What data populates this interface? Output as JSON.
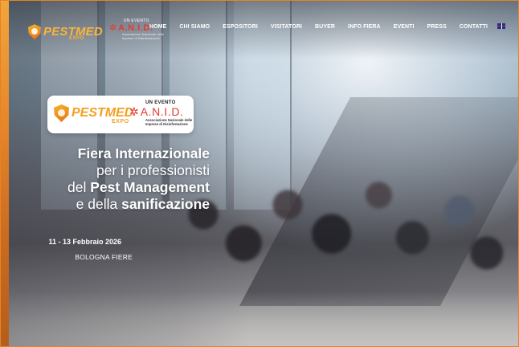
{
  "header": {
    "logo": {
      "brand": "PESTMED",
      "brand_sub": "EXPO",
      "event_label": "UN EVENTO",
      "partner_name": "A.N.I.D.",
      "partner_desc": "Associazione Nazionale delle Imprese di Disinfestazione"
    },
    "nav": [
      "HOME",
      "CHI SIAMO",
      "ESPOSITORI",
      "VISITATORI",
      "BUYER",
      "INFO FIERA",
      "EVENTI",
      "PRESS",
      "CONTATTI"
    ],
    "language_flag": "uk-flag-icon"
  },
  "hero": {
    "logo": {
      "brand": "PESTMED",
      "brand_sub": "EXPO",
      "event_label": "UN EVENTO",
      "partner_name": "A.N.I.D.",
      "partner_desc": "Associazione Nazionale delle Imprese di Disinfestazione"
    },
    "line1": "Fiera Internazionale",
    "line2": "per i professionisti",
    "line3_pre": "del ",
    "line3_bold": "Pest Management",
    "line4_pre": "e della ",
    "line4_bold": "sanificazione",
    "dates": "11 - 13 Febbraio 2026",
    "venue": "BOLOGNA FIERE"
  },
  "colors": {
    "accent_orange": "#f3a023",
    "anid_red": "#e23a32",
    "frame_orange": "#e38424"
  }
}
